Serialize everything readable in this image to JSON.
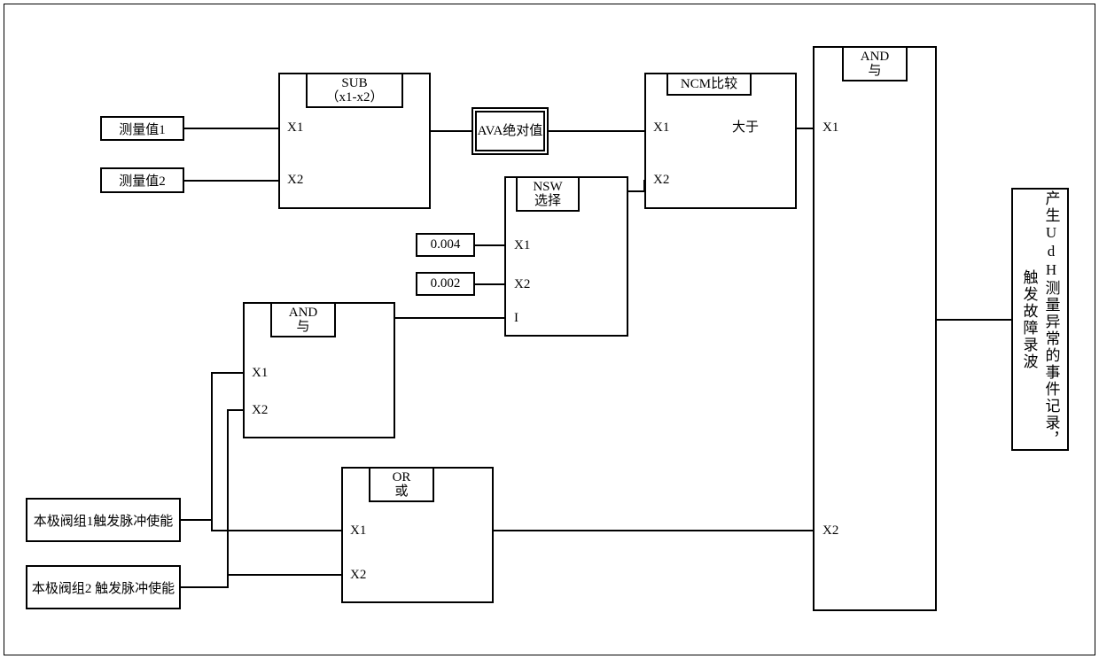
{
  "inputs": {
    "meas1": "测量值1",
    "meas2": "测量值2",
    "const1": "0.004",
    "const2": "0.002",
    "pulse1": "本极阀组1触发脉冲使能",
    "pulse2": "本极阀组2 触发脉冲使能"
  },
  "blocks": {
    "sub": {
      "title": "SUB\n（x1-x2）",
      "p1": "X1",
      "p2": "X2"
    },
    "ava": {
      "title": "AVA绝对值"
    },
    "ncm": {
      "title": "NCM比较",
      "p1": "X1",
      "p2": "X2",
      "out": "大于"
    },
    "nsw": {
      "title": "NSW\n选择",
      "p1": "X1",
      "p2": "X2",
      "p3": "I"
    },
    "and1": {
      "title": "AND\n与",
      "p1": "X1",
      "p2": "X2"
    },
    "or": {
      "title": "OR\n或",
      "p1": "X1",
      "p2": "X2"
    },
    "and2": {
      "title": "AND\n与",
      "p1": "X1",
      "p2": "X2"
    }
  },
  "output": "产生UdH测量异常的事件记录，触发故障录波"
}
